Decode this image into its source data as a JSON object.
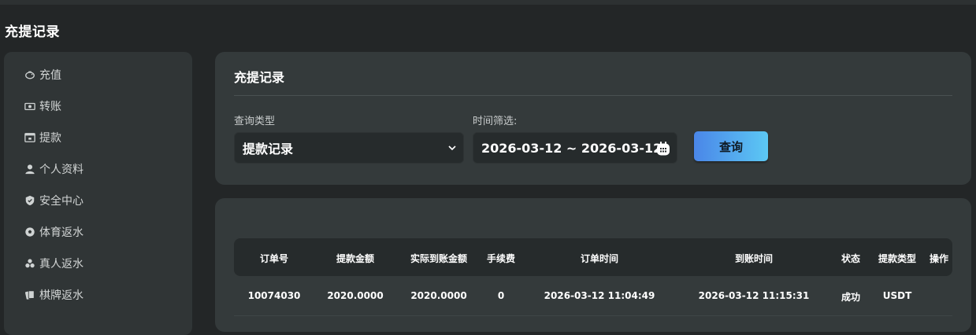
{
  "page": {
    "title": "充提记录"
  },
  "sidebar": {
    "items": [
      {
        "label": "充值",
        "icon": "piggy-bank-icon"
      },
      {
        "label": "转账",
        "icon": "money-transfer-icon"
      },
      {
        "label": "提款",
        "icon": "withdraw-icon"
      },
      {
        "label": "个人资料",
        "icon": "user-icon"
      },
      {
        "label": "安全中心",
        "icon": "shield-icon"
      },
      {
        "label": "体育返水",
        "icon": "soccer-ball-icon"
      },
      {
        "label": "真人返水",
        "icon": "poker-chips-icon"
      },
      {
        "label": "棋牌返水",
        "icon": "cards-icon"
      }
    ]
  },
  "filter": {
    "title": "充提记录",
    "type_label": "查询类型",
    "type_value": "提款记录",
    "time_label": "时间筛选:",
    "date_range": "2026-03-12 ~ 2026-03-12",
    "query_button": "查询"
  },
  "table": {
    "columns": [
      "订单号",
      "提款金额",
      "实际到账金额",
      "手续费",
      "订单时间",
      "到账时间",
      "状态",
      "提款类型",
      "操作"
    ],
    "rows": [
      [
        "10074030",
        "2020.0000",
        "2020.0000",
        "0",
        "2026-03-12 11:04:49",
        "2026-03-12 11:15:31",
        "成功",
        "USDT",
        ""
      ]
    ]
  },
  "colors": {
    "background": "#232627",
    "panel": "#343a3b",
    "sidebar": "#303536",
    "input": "#262b2c",
    "button_gradient_start": "#4a86e8",
    "button_gradient_end": "#5cc8f4"
  }
}
